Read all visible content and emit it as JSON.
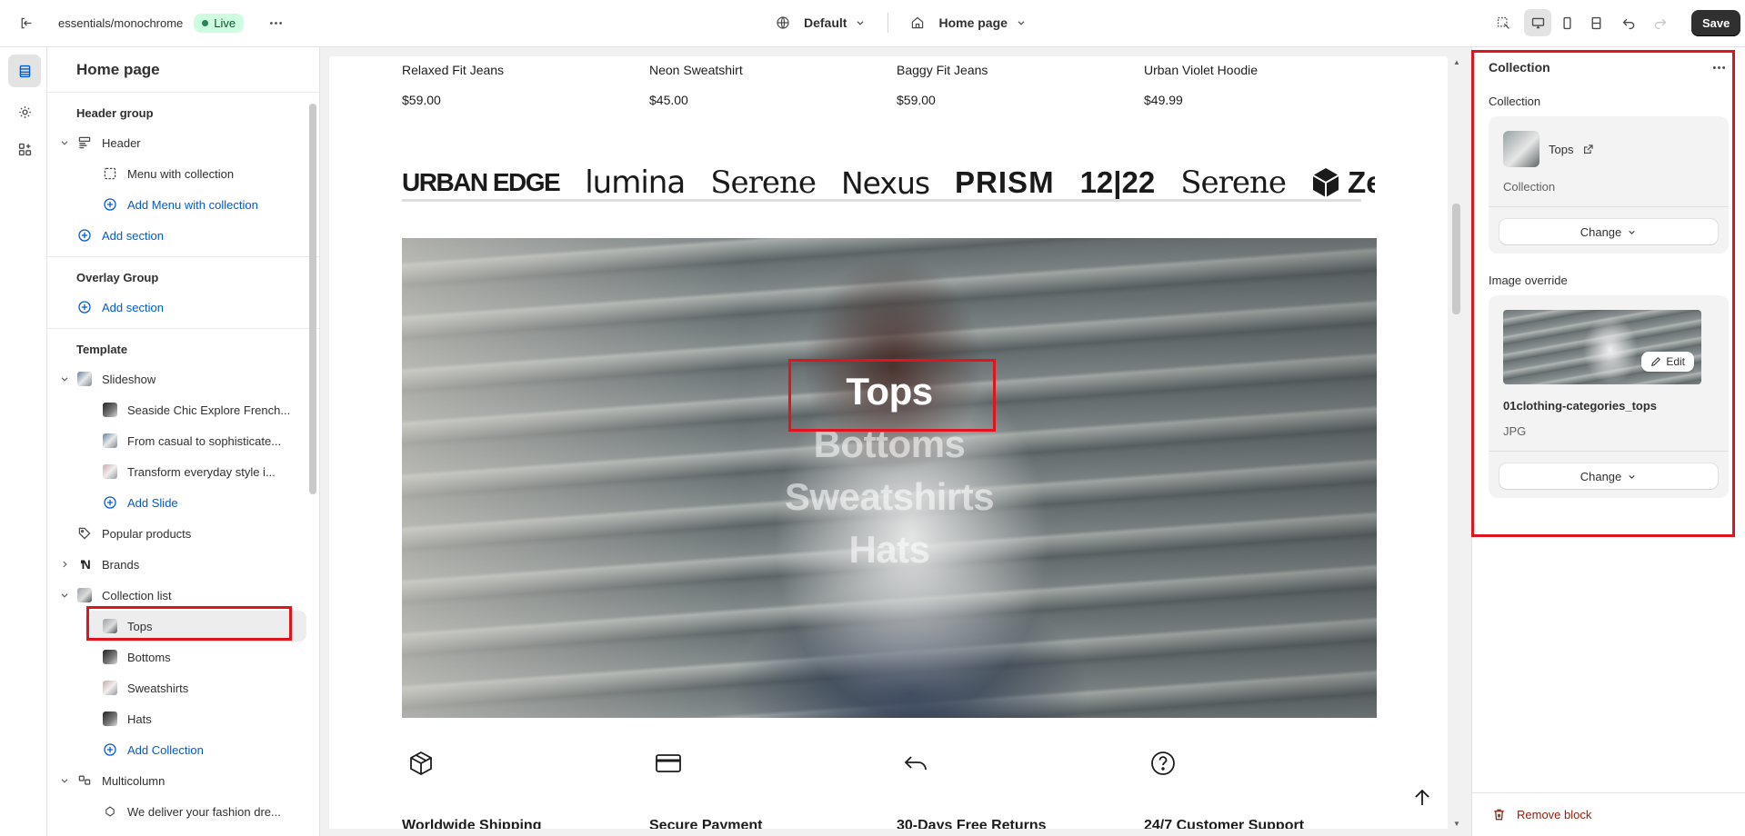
{
  "topbar": {
    "store": "essentials/monochrome",
    "status": "Live",
    "theme_selector": "Default",
    "page_selector": "Home page",
    "save_label": "Save"
  },
  "left_panel": {
    "title": "Home page",
    "header_group": {
      "heading": "Header group",
      "header": "Header",
      "menu": "Menu with collection",
      "add_menu": "Add Menu with collection",
      "add_section": "Add section"
    },
    "overlay_group": {
      "heading": "Overlay Group",
      "add_section": "Add section"
    },
    "template": {
      "heading": "Template",
      "slideshow": "Slideshow",
      "slides": [
        "Seaside Chic Explore French...",
        "From casual to sophisticate...",
        "Transform everyday style i..."
      ],
      "add_slide": "Add Slide",
      "popular": "Popular products",
      "brands": "Brands",
      "collection_list": "Collection list",
      "collections": [
        "Tops",
        "Bottoms",
        "Sweatshirts",
        "Hats"
      ],
      "add_collection": "Add Collection",
      "multicolumn": "Multicolumn",
      "multicolumn_item": "We deliver your fashion dre..."
    }
  },
  "preview": {
    "products": [
      {
        "name": "Relaxed Fit Jeans",
        "price": "$59.00"
      },
      {
        "name": "Neon Sweatshirt",
        "price": "$45.00"
      },
      {
        "name": "Baggy Fit Jeans",
        "price": "$59.00"
      },
      {
        "name": "Urban Violet Hoodie",
        "price": "$49.99"
      }
    ],
    "brands": [
      "URBAN EDGE",
      "lumina",
      "Serene",
      "Nexus",
      "PRISM",
      "12|22",
      "Serene",
      "Ze"
    ],
    "collections": [
      "Tops",
      "Bottoms",
      "Sweatshirts",
      "Hats"
    ],
    "features": [
      "Worldwide Shipping",
      "Secure Payment",
      "30-Days Free Returns",
      "24/7 Customer Support"
    ]
  },
  "right_panel": {
    "title": "Collection",
    "collection_label": "Collection",
    "collection_name": "Tops",
    "collection_type": "Collection",
    "change": "Change",
    "image_label": "Image override",
    "edit": "Edit",
    "filename": "01clothing-categories_tops",
    "filetype": "JPG",
    "remove": "Remove block"
  },
  "colors": {
    "accent_blue": "#005bd3",
    "highlight_red": "#e0141e",
    "live_badge": "#cdfee1",
    "save_button": "#303030"
  }
}
